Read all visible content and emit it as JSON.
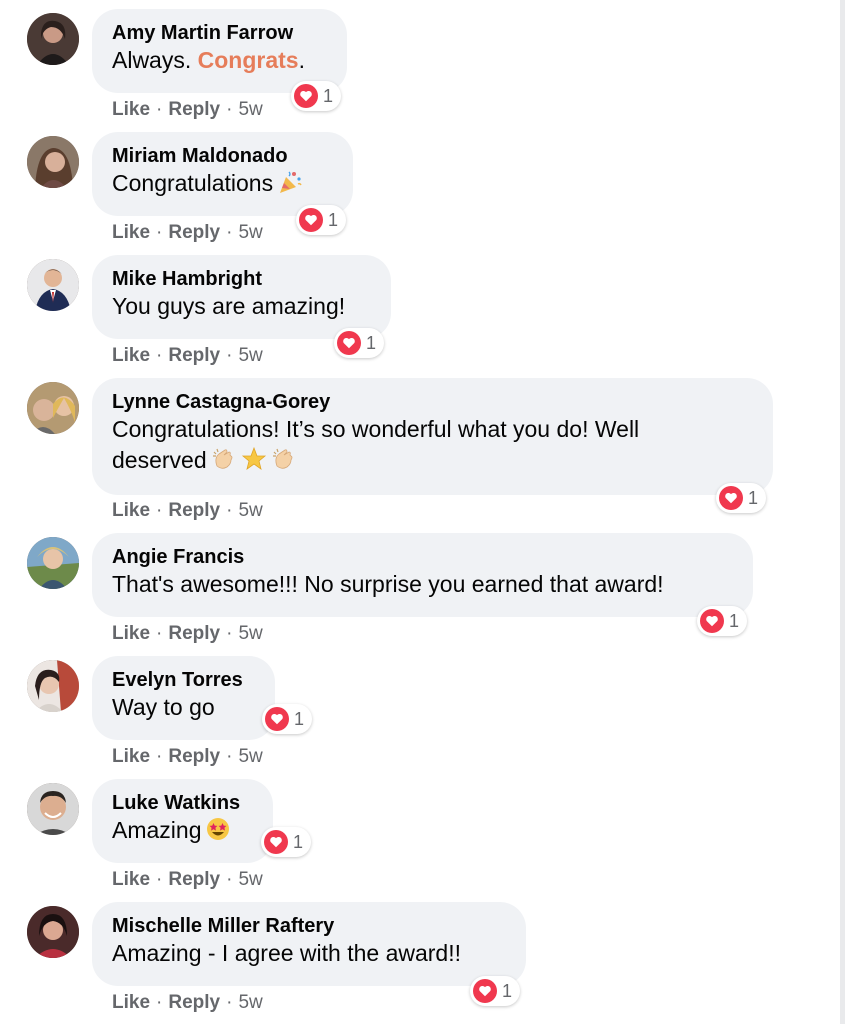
{
  "comments": [
    {
      "author": "Amy Martin Farrow",
      "text_pre": "Always. ",
      "text_link": "Congrats",
      "text_post": ".",
      "reactions": "1",
      "like": "Like",
      "reply": "Reply",
      "time": "5w"
    },
    {
      "author": "Miriam Maldonado",
      "text": "Congratulations",
      "emoji": "party-popper-emoji",
      "reactions": "1",
      "like": "Like",
      "reply": "Reply",
      "time": "5w"
    },
    {
      "author": "Mike Hambright",
      "text": "You guys are amazing!",
      "reactions": "1",
      "like": "Like",
      "reply": "Reply",
      "time": "5w"
    },
    {
      "author": "Lynne Castagna-Gorey",
      "text": "Congratulations! It’s so wonderful what you do! Well deserved",
      "emoji": [
        "clapping-hands-emoji",
        "star-emoji",
        "clapping-hands-emoji"
      ],
      "reactions": "1",
      "like": "Like",
      "reply": "Reply",
      "time": "5w"
    },
    {
      "author": "Angie Francis",
      "text": "That's awesome!!! No surprise you earned that award!",
      "reactions": "1",
      "like": "Like",
      "reply": "Reply",
      "time": "5w"
    },
    {
      "author": "Evelyn Torres",
      "text": "Way to go",
      "reactions": "1",
      "like": "Like",
      "reply": "Reply",
      "time": "5w"
    },
    {
      "author": "Luke Watkins",
      "text": "Amazing",
      "emoji": "star-struck-emoji",
      "reactions": "1",
      "like": "Like",
      "reply": "Reply",
      "time": "5w"
    },
    {
      "author": "Mischelle Miller Raftery",
      "text": "Amazing - I agree with the award!!",
      "reactions": "1",
      "like": "Like",
      "reply": "Reply",
      "time": "5w"
    }
  ],
  "separator": "·",
  "colors": {
    "bubble": "#f0f2f5",
    "heart": "#f0384e",
    "secondary_text": "#65676b",
    "link_word": "#e67d5a"
  }
}
